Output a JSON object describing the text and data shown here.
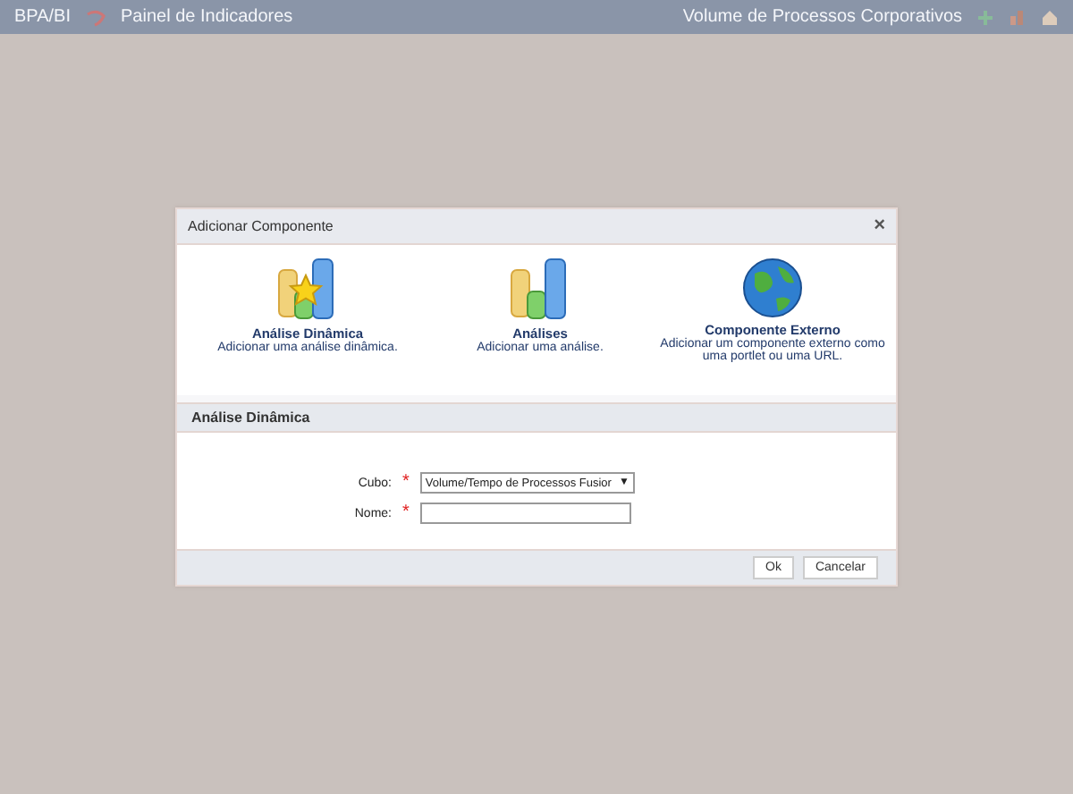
{
  "top_bar": {
    "app": "BPA/BI",
    "title": "Painel de Indicadores",
    "context": "Volume de Processos Corporativos"
  },
  "dialog": {
    "title": "Adicionar Componente",
    "close": "×",
    "components": [
      {
        "kind": "dynamic",
        "name": "Análise Dinâmica",
        "description": "Adicionar uma análise dinâmica."
      },
      {
        "kind": "analysis",
        "name": "Análises",
        "description": "Adicionar uma análise."
      },
      {
        "kind": "external",
        "name": "Componente Externo",
        "description": "Adicionar um componente externo como uma portlet ou uma URL."
      }
    ],
    "section_title": "Análise Dinâmica",
    "fields": [
      {
        "kind": "select",
        "label": "Cubo:",
        "required_mark": "*",
        "value": "Volume/Tempo de Processos Fusior",
        "arrow": "▼"
      },
      {
        "kind": "text",
        "label": "Nome:",
        "required_mark": "*"
      }
    ],
    "buttons": [
      "Ok",
      "Cancelar"
    ]
  }
}
